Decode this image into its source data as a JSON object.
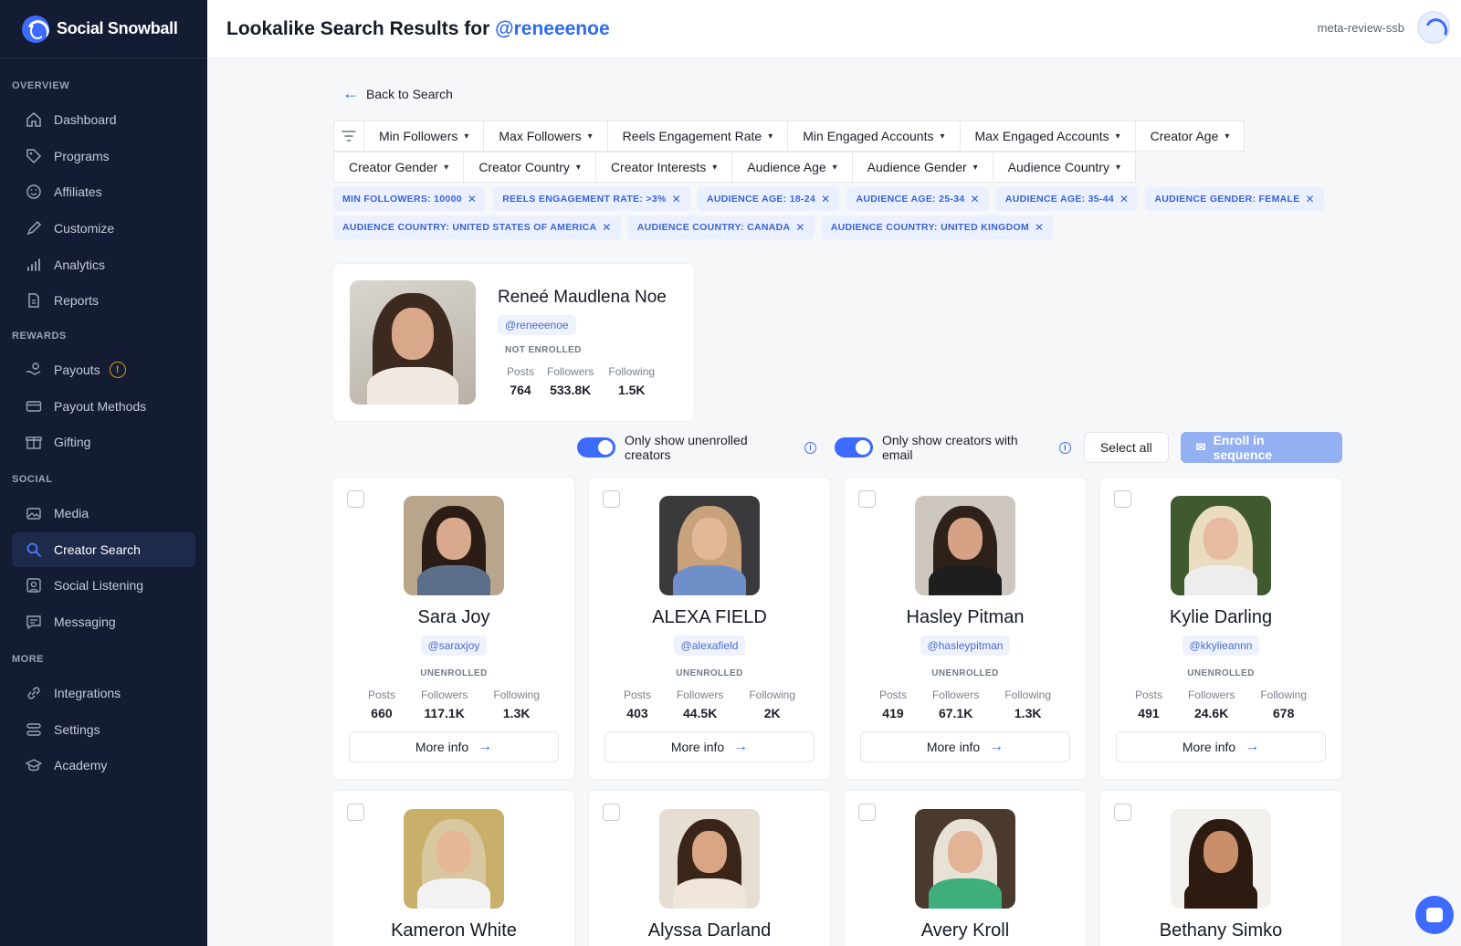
{
  "brand": {
    "name": "Social Snowball"
  },
  "sidebar": {
    "sections": [
      {
        "label": "OVERVIEW",
        "items": [
          {
            "label": "Dashboard",
            "icon": "home-icon"
          },
          {
            "label": "Programs",
            "icon": "tag-icon"
          },
          {
            "label": "Affiliates",
            "icon": "smile-icon"
          },
          {
            "label": "Customize",
            "icon": "pen-icon"
          },
          {
            "label": "Analytics",
            "icon": "bar-chart-icon"
          },
          {
            "label": "Reports",
            "icon": "document-icon"
          }
        ]
      },
      {
        "label": "REWARDS",
        "items": [
          {
            "label": "Payouts",
            "icon": "hand-coins-icon",
            "warning": "!"
          },
          {
            "label": "Payout Methods",
            "icon": "credit-card-icon"
          },
          {
            "label": "Gifting",
            "icon": "gift-icon"
          }
        ]
      },
      {
        "label": "SOCIAL",
        "items": [
          {
            "label": "Media",
            "icon": "media-icon"
          },
          {
            "label": "Creator Search",
            "icon": "search-icon",
            "active": true
          },
          {
            "label": "Social Listening",
            "icon": "ear-icon"
          },
          {
            "label": "Messaging",
            "icon": "message-icon"
          }
        ]
      },
      {
        "label": "MORE",
        "items": [
          {
            "label": "Integrations",
            "icon": "link-icon"
          },
          {
            "label": "Settings",
            "icon": "sliders-icon"
          },
          {
            "label": "Academy",
            "icon": "graduation-cap-icon"
          }
        ]
      }
    ]
  },
  "header": {
    "title_prefix": "Lookalike Search Results for ",
    "title_handle": "@reneeenoe",
    "account_name": "meta-review-ssb"
  },
  "back_label": "Back to Search",
  "filters": {
    "row1": [
      "Min Followers",
      "Max Followers",
      "Reels Engagement Rate",
      "Min Engaged Accounts",
      "Max Engaged Accounts",
      "Creator Age"
    ],
    "row2": [
      "Creator Gender",
      "Creator Country",
      "Creator Interests",
      "Audience Age",
      "Audience Gender",
      "Audience Country"
    ]
  },
  "chips": {
    "row1": [
      "MIN FOLLOWERS: 10000",
      "REELS ENGAGEMENT RATE: >3%",
      "AUDIENCE AGE: 18-24",
      "AUDIENCE AGE: 25-34",
      "AUDIENCE AGE: 35-44",
      "AUDIENCE GENDER: FEMALE"
    ],
    "row2": [
      "AUDIENCE COUNTRY: UNITED STATES OF AMERICA",
      "AUDIENCE COUNTRY: CANADA",
      "AUDIENCE COUNTRY: UNITED KINGDOM"
    ]
  },
  "reference": {
    "name": "Reneé Maudlena Noe",
    "handle": "@reneeenoe",
    "status": "NOT ENROLLED",
    "stats": {
      "posts_label": "Posts",
      "posts": "764",
      "followers_label": "Followers",
      "followers": "533.8K",
      "following_label": "Following",
      "following": "1.5K"
    }
  },
  "toggles": {
    "unenrolled": "Only show unenrolled creators",
    "with_email": "Only show creators with email",
    "select_all": "Select all",
    "enroll": "Enroll in sequence"
  },
  "labels": {
    "posts": "Posts",
    "followers": "Followers",
    "following": "Following",
    "more_info": "More info"
  },
  "creators": [
    {
      "name": "Sara Joy",
      "handle": "@saraxjoy",
      "status": "UNENROLLED",
      "posts": "660",
      "followers": "117.1K",
      "following": "1.3K"
    },
    {
      "name": "ALEXA FIELD",
      "handle": "@alexafield",
      "status": "UNENROLLED",
      "posts": "403",
      "followers": "44.5K",
      "following": "2K"
    },
    {
      "name": "Hasley Pitman",
      "handle": "@hasleypitman",
      "status": "UNENROLLED",
      "posts": "419",
      "followers": "67.1K",
      "following": "1.3K"
    },
    {
      "name": "Kylie Darling",
      "handle": "@kkylieannn",
      "status": "UNENROLLED",
      "posts": "491",
      "followers": "24.6K",
      "following": "678"
    },
    {
      "name": "Kameron White"
    },
    {
      "name": "Alyssa Darland"
    },
    {
      "name": "Avery Kroll"
    },
    {
      "name": "Bethany Simko"
    }
  ]
}
